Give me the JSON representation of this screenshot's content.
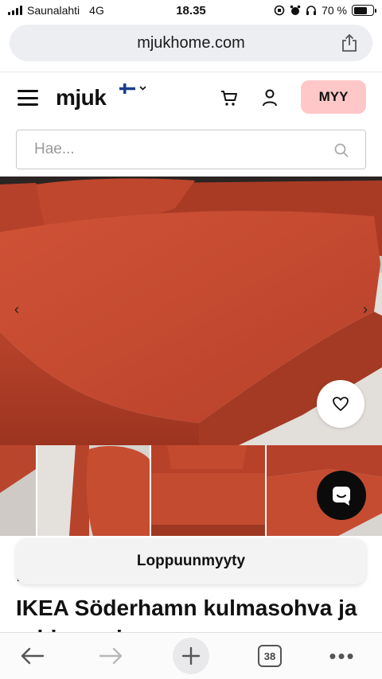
{
  "status_bar": {
    "carrier": "Saunalahti",
    "network": "4G",
    "time": "18.35",
    "battery": "70 %",
    "battery_level": 0.7
  },
  "browser": {
    "url": "mjukhome.com",
    "tabs_count": "38"
  },
  "header": {
    "logo": "mjuk",
    "sell_button": "MYY"
  },
  "search": {
    "placeholder": "Hae..."
  },
  "product": {
    "status_banner": "Loppuunmyyty",
    "breadcrumb": "L",
    "title": "IKEA Söderhamn kulmasohva ja rahi punainen"
  },
  "colors": {
    "accent": "#ffc7c7",
    "sofa": "#c4492e",
    "sofa_dark": "#a53a24"
  },
  "icons": {
    "menu": "hamburger-icon",
    "cart": "cart-icon",
    "user": "user-icon",
    "search": "search-icon",
    "favorite": "heart-icon",
    "chat": "chat-icon",
    "share": "share-icon",
    "back": "back-arrow-icon",
    "forward": "forward-arrow-icon",
    "new_tab": "plus-icon",
    "more": "more-icon"
  }
}
